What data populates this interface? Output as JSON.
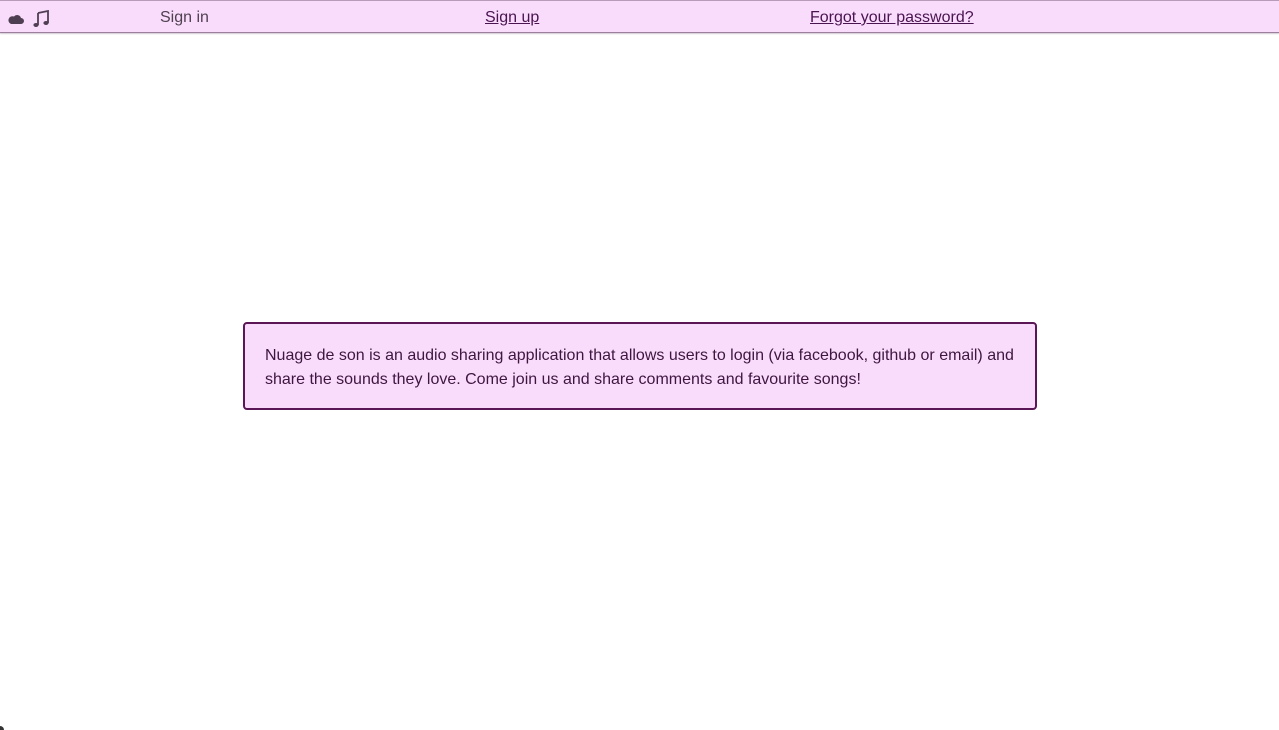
{
  "topbar": {
    "logo_icons": [
      "cloud-icon",
      "music-note-icon"
    ],
    "sign_in_label": "Sign in",
    "sign_up_label": "Sign up",
    "forgot_password_label": "Forgot your password?"
  },
  "about": {
    "text": "Nuage de son is an audio sharing application that allows users to login (via facebook, github or email) and share the sounds they love. Come join us and share comments and favourite songs!"
  },
  "colors": {
    "topbar_background": "#f9dcfb",
    "box_background": "#f9dcfb",
    "box_border": "#5a1655",
    "link_color": "#4a1450"
  }
}
